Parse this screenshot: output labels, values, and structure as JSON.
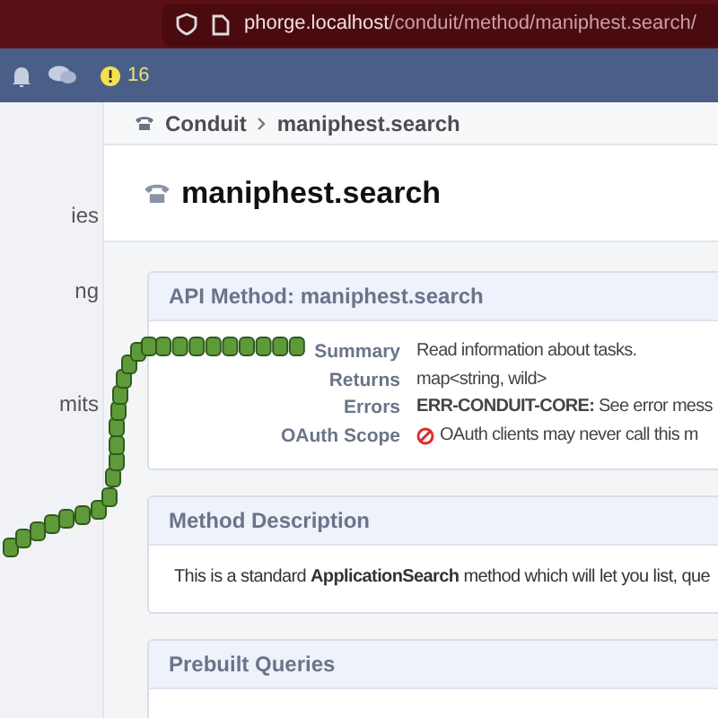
{
  "browser": {
    "url_host": "phorge.localhost",
    "url_path": "/conduit/method/maniphest.search/"
  },
  "topbar": {
    "alert_count": "16"
  },
  "sidebar": {
    "items": [
      "ies",
      "ng",
      "mits"
    ]
  },
  "breadcrumbs": [
    "Conduit",
    "maniphest.search"
  ],
  "page_title": "maniphest.search",
  "api_method": {
    "header": "API Method: maniphest.search",
    "rows": [
      {
        "label": "Summary",
        "value": "Read information about tasks.",
        "kind": "text"
      },
      {
        "label": "Returns",
        "value": "map<string, wild>",
        "kind": "text"
      },
      {
        "label": "Errors",
        "value": "**ERR-CONDUIT-CORE:** See error mess",
        "kind": "rich"
      },
      {
        "label": "OAuth Scope",
        "value": "OAuth clients may never call this m",
        "kind": "blocked"
      }
    ]
  },
  "method_description": {
    "header": "Method Description",
    "text": "This is a standard **ApplicationSearch** method which will let you list, que"
  },
  "prebuilt_queries": {
    "header": "Prebuilt Queries"
  }
}
